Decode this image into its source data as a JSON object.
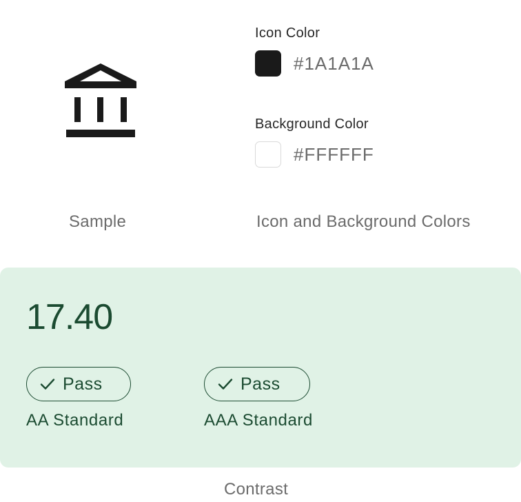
{
  "sample": {
    "icon": "bank-icon",
    "caption": "Sample"
  },
  "colors": {
    "icon_color": {
      "label": "Icon Color",
      "value": "#1A1A1A",
      "swatch": "#1A1A1A"
    },
    "background_color": {
      "label": "Background Color",
      "value": "#FFFFFF",
      "swatch": "#FFFFFF"
    },
    "caption": "Icon and Background Colors"
  },
  "contrast": {
    "ratio": "17.40",
    "aa": {
      "status": "Pass",
      "label": "AA Standard"
    },
    "aaa": {
      "status": "Pass",
      "label": "AAA Standard"
    },
    "caption": "Contrast",
    "panel_color": "#E0F2E6",
    "text_color": "#1B4B31"
  }
}
